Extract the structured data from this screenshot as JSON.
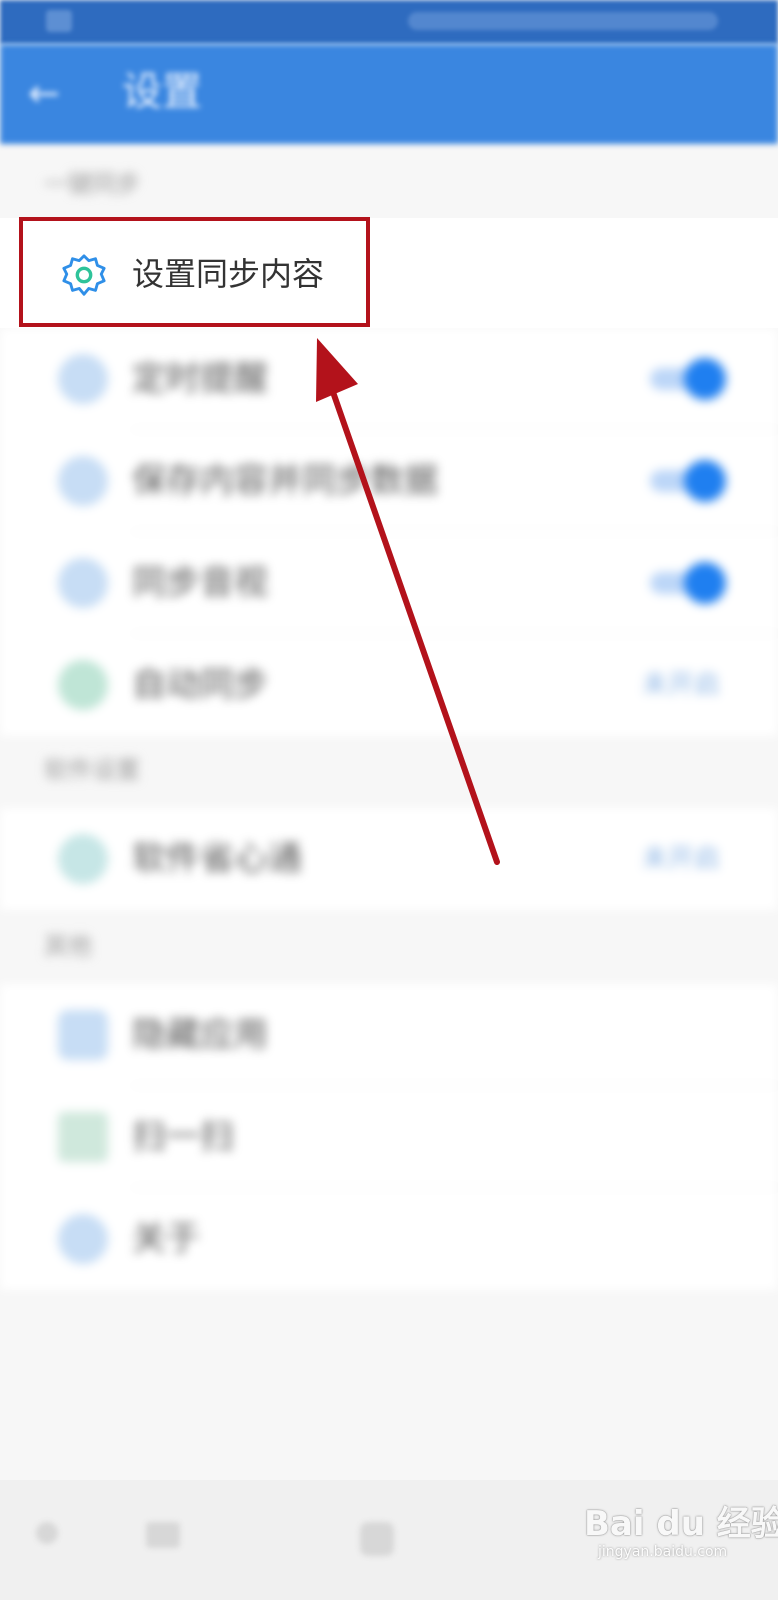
{
  "status_bar": {},
  "app_bar": {
    "back_label": "←",
    "title": "设置"
  },
  "sections": [
    {
      "label": "一键同步"
    },
    {
      "label": "软件设置"
    },
    {
      "label": "其他"
    }
  ],
  "focused_item": {
    "label": "设置同步内容",
    "icon": "gear-icon"
  },
  "sync_items": [
    {
      "label": "定时提醒",
      "control": "toggle",
      "on": true
    },
    {
      "label": "保存内容并同步数据",
      "control": "toggle",
      "on": true
    },
    {
      "label": "同步音视",
      "control": "toggle",
      "on": true
    },
    {
      "label": "自动同步",
      "control": "value",
      "value": "未开启"
    }
  ],
  "software_items": [
    {
      "label": "软件省心通",
      "control": "value",
      "value": "未开启"
    }
  ],
  "other_items": [
    {
      "label": "隐藏应用"
    },
    {
      "label": "扫一扫"
    },
    {
      "label": "关于"
    }
  ],
  "watermark": {
    "brand": "Bai du 经验",
    "url": "jingyan.baidu.com"
  },
  "colors": {
    "app_bar": "#3a86e0",
    "highlight": "#b3121b",
    "toggle_on": "#1f7ff0"
  }
}
